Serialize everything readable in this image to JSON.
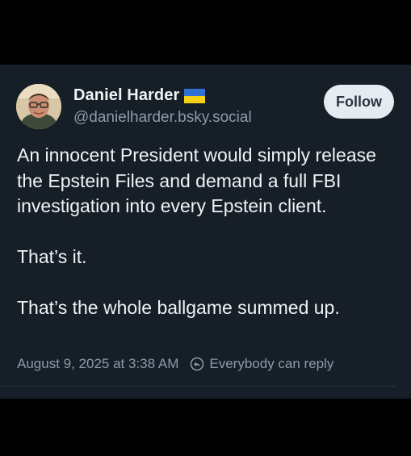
{
  "post": {
    "author": {
      "display_name": "Daniel Harder",
      "handle": "@danielharder.bsky.social",
      "flag_icon": "ukraine-flag-icon",
      "avatar_icon": "avatar-photo"
    },
    "follow_label": "Follow",
    "body": {
      "paragraph_1": "An innocent President would simply release the Epstein Files and demand a full FBI investigation into every Epstein client.",
      "paragraph_2": "That’s it.",
      "paragraph_3": "That’s the whole ballgame summed up."
    },
    "timestamp": "August 9, 2025 at 3:38 AM",
    "reply_setting": "Everybody can reply",
    "reply_icon": "reply-permission-icon"
  },
  "colors": {
    "page_background": "#000000",
    "card_background": "#161e27",
    "primary_text": "#f1f3f5",
    "secondary_text": "#8d9aaa",
    "follow_button_bg": "#e6ebf2",
    "follow_button_text": "#2b3440",
    "flag_blue": "#2f6fd6",
    "flag_yellow": "#f7d117"
  }
}
